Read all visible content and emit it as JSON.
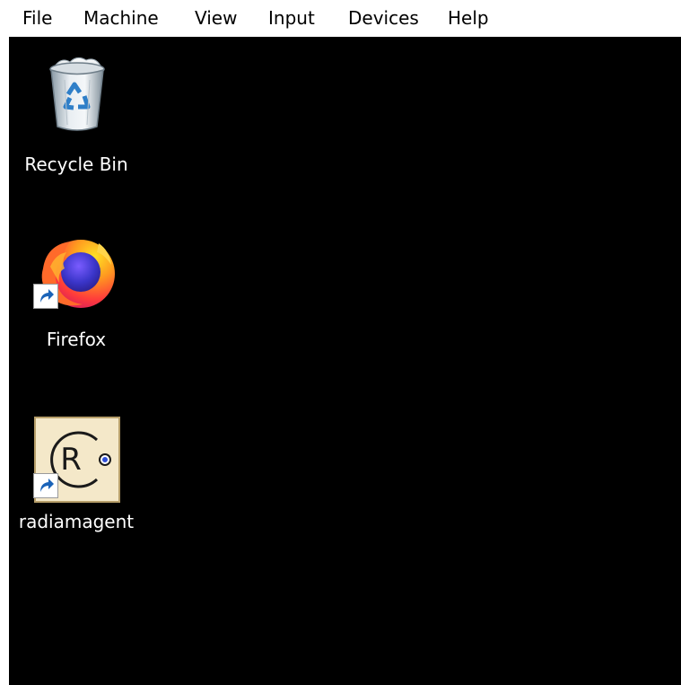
{
  "menu": {
    "items": [
      {
        "label": "File"
      },
      {
        "label": "Machine"
      },
      {
        "label": "View"
      },
      {
        "label": "Input"
      },
      {
        "label": "Devices"
      },
      {
        "label": "Help"
      }
    ]
  },
  "desktop": {
    "background_color": "#000000",
    "icons": [
      {
        "label": "Recycle Bin",
        "icon": "recycle-bin-icon"
      },
      {
        "label": "Firefox",
        "icon": "firefox-icon",
        "shortcut": true
      },
      {
        "label": "radiamagent",
        "icon": "radiamagent-icon",
        "shortcut": true
      }
    ]
  }
}
